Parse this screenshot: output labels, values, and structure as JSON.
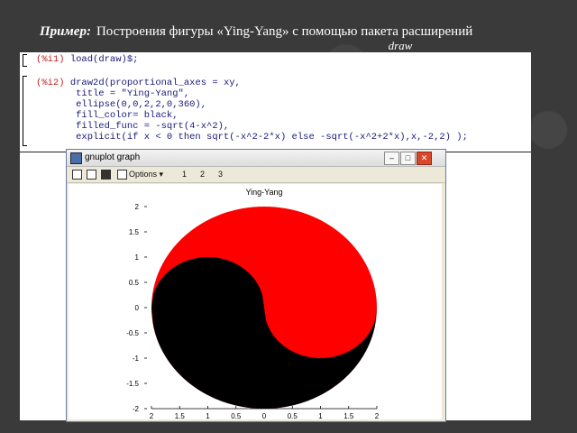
{
  "slide": {
    "title_bold": "Пример:",
    "title_text": "Построения фигуры «Ying-Yang» с помощью пакета расширений",
    "title_suffix": "draw"
  },
  "code": {
    "line1_prompt": "(%i1)",
    "line1_code": " load(draw)$;",
    "line2_prompt": "(%i2)",
    "line2_code": " draw2d(proportional_axes = xy,",
    "line3": "       title = \"Ying-Yang\",",
    "line4": "       ellipse(0,0,2,2,0,360),",
    "line5": "       fill_color= black,",
    "line6": "       filled_func = -sqrt(4-x^2),",
    "line7": "       explicit(if x < 0 then sqrt(-x^2-2*x) else -sqrt(-x^2+2*x),x,-2,2) );"
  },
  "window": {
    "title": "gnuplot graph",
    "options_label": "Options ▾",
    "toolbar_items": [
      "1",
      "2",
      "3"
    ],
    "minimize": "–",
    "maximize": "□",
    "close": "✕"
  },
  "chart_data": {
    "type": "area",
    "title": "Ying-Yang",
    "xlabel": "",
    "ylabel": "",
    "xlim": [
      -2,
      2
    ],
    "ylim": [
      -2,
      2
    ],
    "x_ticks": [
      "2",
      "1.5",
      "1",
      "0.5",
      "0",
      "0.5",
      "1",
      "1.5",
      "2"
    ],
    "y_ticks": [
      "2",
      "1.5",
      "1",
      "0.5",
      "0",
      "-0.5",
      "-1",
      "-1.5",
      "-2"
    ],
    "y_tick_values": [
      2,
      1.5,
      1,
      0.5,
      0,
      -0.5,
      -1,
      -1.5,
      -2
    ],
    "x_tick_values": [
      -2,
      -1.5,
      -1,
      -0.5,
      0,
      0.5,
      1,
      1.5,
      2
    ],
    "circle": {
      "cx": 0,
      "cy": 0,
      "r": 2
    },
    "colors": {
      "upper": "#ff0000",
      "lower": "#000000"
    }
  }
}
